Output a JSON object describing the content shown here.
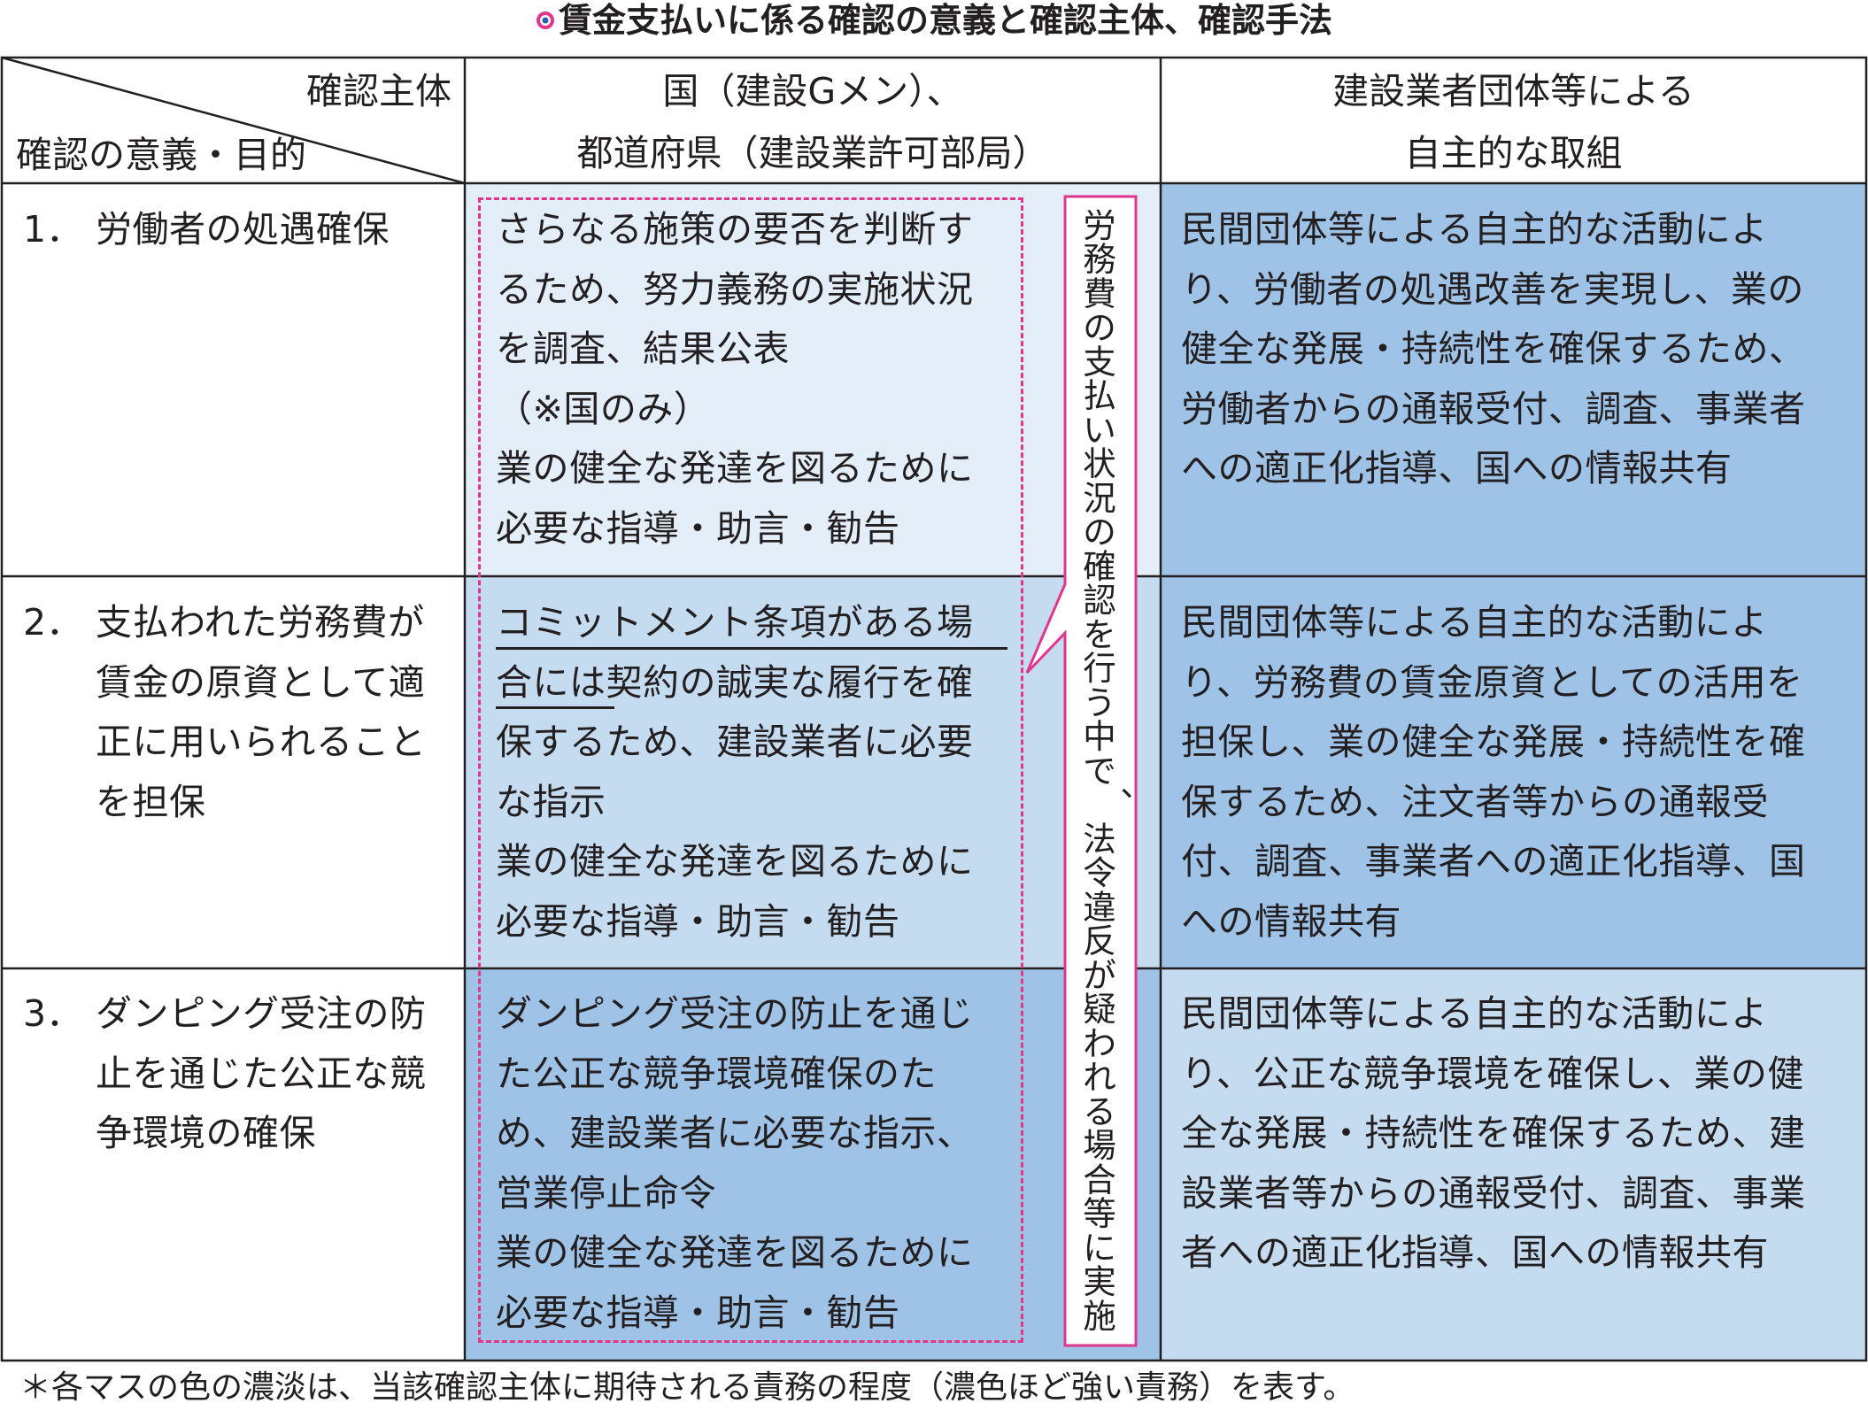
{
  "title": "賃金支払いに係る確認の意義と確認主体、確認手法",
  "header": {
    "corner_top": "確認主体",
    "corner_bottom": "確認の意義・目的",
    "col2": "国（建設Gメン）、\n都道府県（建設業許可部局）",
    "col3": "建設業者団体等による\n自主的な取組"
  },
  "rows": [
    {
      "num": "1．",
      "label": "労働者の処遇確保",
      "gov": "さらなる施策の要否を判断す\nるため、努力義務の実施状況\nを調査、結果公表\n（※国のみ）\n業の健全な発達を図るために\n必要な指導・助言・勧告",
      "private": "民間団体等による自主的な活動によ\nり、労働者の処遇改善を実現し、業の\n健全な発展・持続性を確保するため、\n労働者からの通報受付、調査、事業者\nへの適正化指導、国への情報共有"
    },
    {
      "num": "2．",
      "label": "支払われた労務費が\n賃金の原資として適\n正に用いられること\nを担保",
      "gov": "コミットメント条項がある場\n合には契約の誠実な履行を確\n保するため、建設業者に必要\nな指示\n業の健全な発達を図るために\n必要な指導・助言・勧告",
      "private": "民間団体等による自主的な活動によ\nり、労務費の賃金原資としての活用を\n担保し、業の健全な発展・持続性を確\n保するため、注文者等からの通報受\n付、調査、事業者への適正化指導、国\nへの情報共有"
    },
    {
      "num": "3．",
      "label": "ダンピング受注の防\n止を通じた公正な競\n争環境の確保",
      "gov": "ダンピング受注の防止を通じ\nた公正な競争環境確保のた\nめ、建設業者に必要な指示、\n営業停止命令\n業の健全な発達を図るために\n必要な指導・助言・勧告",
      "private": "民間団体等による自主的な活動によ\nり、公正な競争環境を確保し、業の健\n全な発展・持続性を確保するため、建\n設業者等からの通報受付、調査、事業\n者への適正化指導、国への情報共有"
    }
  ],
  "callout": "労務費の支払い状況の確認を行う中で、法令違反が疑われる場合等に実施",
  "footnote": "＊各マスの色の濃淡は、当該確認主体に期待される責務の程度（濃色ほど強い責務）を表す。",
  "colors": {
    "light": "#e3eef9",
    "medium": "#c5dcf0",
    "dark": "#9fc3e6",
    "dashed_border": "#e0378a",
    "title_mark": "#e0378a",
    "title_mark_inner": "#2b5fa8",
    "text": "#231f20"
  }
}
